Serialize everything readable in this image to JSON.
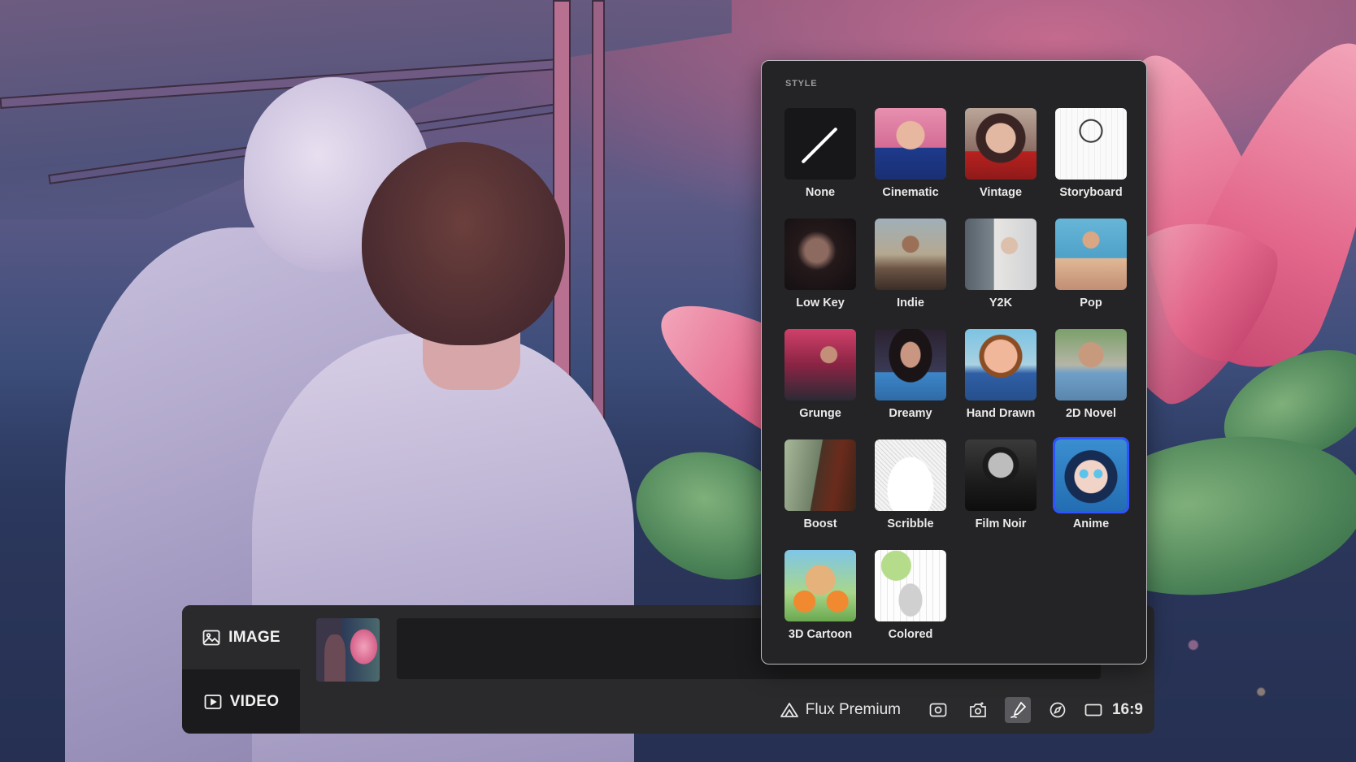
{
  "style_panel": {
    "title": "STYLE",
    "selected": "Anime",
    "accent_color": "#2f54ff",
    "items": [
      {
        "label": "None",
        "name": "style-none",
        "art": "t-none"
      },
      {
        "label": "Cinematic",
        "name": "style-cinematic",
        "art": "t-cinematic"
      },
      {
        "label": "Vintage",
        "name": "style-vintage",
        "art": "t-vintage"
      },
      {
        "label": "Storyboard",
        "name": "style-storyboard",
        "art": "t-storyboard"
      },
      {
        "label": "Low Key",
        "name": "style-low-key",
        "art": "t-lowkey"
      },
      {
        "label": "Indie",
        "name": "style-indie",
        "art": "t-indie"
      },
      {
        "label": "Y2K",
        "name": "style-y2k",
        "art": "t-y2k"
      },
      {
        "label": "Pop",
        "name": "style-pop",
        "art": "t-pop"
      },
      {
        "label": "Grunge",
        "name": "style-grunge",
        "art": "t-grunge"
      },
      {
        "label": "Dreamy",
        "name": "style-dreamy",
        "art": "t-dreamy"
      },
      {
        "label": "Hand Drawn",
        "name": "style-hand-drawn",
        "art": "t-handdrawn"
      },
      {
        "label": "2D Novel",
        "name": "style-2d-novel",
        "art": "t-2dnovel"
      },
      {
        "label": "Boost",
        "name": "style-boost",
        "art": "t-boost"
      },
      {
        "label": "Scribble",
        "name": "style-scribble",
        "art": "t-scribble"
      },
      {
        "label": "Film Noir",
        "name": "style-film-noir",
        "art": "t-filmnoir"
      },
      {
        "label": "Anime",
        "name": "style-anime",
        "art": "t-anime"
      },
      {
        "label": "3D Cartoon",
        "name": "style-3d-cartoon",
        "art": "t-3dcartoon"
      },
      {
        "label": "Colored",
        "name": "style-colored",
        "art": "t-colored"
      }
    ]
  },
  "gen_bar": {
    "modes": {
      "image_label": "IMAGE",
      "video_label": "VIDEO",
      "active": "VIDEO"
    },
    "reference_thumbnail_icon": "thumbnail-image",
    "prompt_placeholder": "",
    "toolbar": {
      "model_label": "Flux Premium",
      "model_icon": "flux-logo-icon",
      "tools": [
        {
          "name": "image-reference-icon",
          "active": false
        },
        {
          "name": "camera-add-icon",
          "active": false
        },
        {
          "name": "style-brush-icon",
          "active": true
        },
        {
          "name": "compass-icon",
          "active": false
        }
      ],
      "aspect_ratio_icon": "aspect-ratio-icon",
      "aspect_ratio_label": "16:9"
    }
  }
}
